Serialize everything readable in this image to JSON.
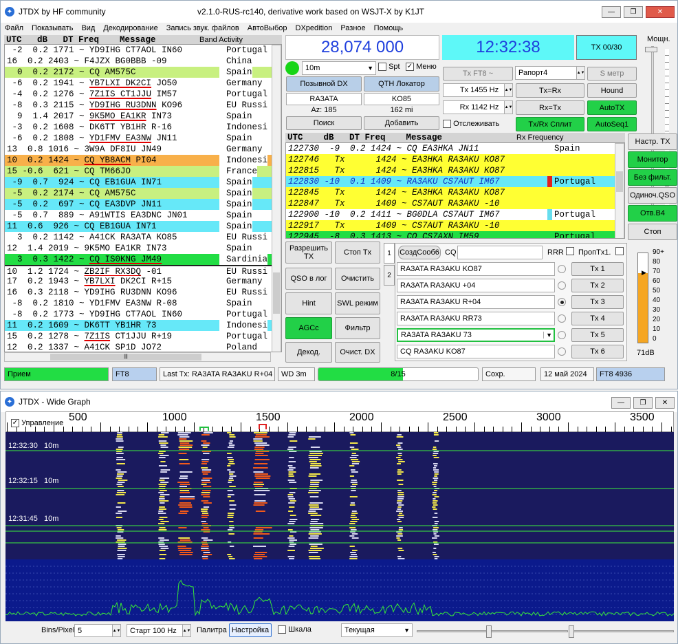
{
  "main": {
    "title": "JTDX   by HF community",
    "version": "v2.1.0-RUS-rc140, derivative work based on WSJT-X by K1JT",
    "menu": [
      "Файл",
      "Показывать",
      "Вид",
      "Декодирование",
      "Запись звук. файлов",
      "АвтоВыбор",
      "DXpedition",
      "Разное",
      "Помощь"
    ]
  },
  "band_activity": {
    "header": "UTC   dB   DT Freq    Message",
    "label": "Band Activity",
    "rows": [
      {
        "t": " -2  0.2 1771 ~ YD9IHG CT7AOL IN60",
        "c": "Portugal",
        "bg": "#ffffff",
        "bar": "#f0a030"
      },
      {
        "t": "16  0.2 2403 ~ F4JZX BG0BBB -09",
        "c": "China",
        "bg": "#ffffff",
        "bar": "#f0a030"
      },
      {
        "t": "  0  0.2 2172 ~ CQ AM575C",
        "c": "Spain",
        "bg": "#c8f080",
        "bar": ""
      },
      {
        "t": " -6  0.2 1941 ~ YB7LXI DK2CI JO50",
        "c": "Germany",
        "bg": "#ffffff",
        "bar": "",
        "u": "YB7LXI DK2CI"
      },
      {
        "t": " -4  0.2 1276 ~ 7Z1IS CT1JJU IM57",
        "c": "Portugal",
        "bg": "#ffffff",
        "bar": "",
        "u": "7Z1IS CT1JJU"
      },
      {
        "t": " -8  0.3 2115 ~ YD9IHG RU3DNN KO96",
        "c": "EU Russi",
        "bg": "#ffffff",
        "bar": "#22c040",
        "u": "YD9IHG RU3DNN"
      },
      {
        "t": "  9  1.4 2017 ~ 9K5MO EA1KR IN73",
        "c": "Spain",
        "bg": "#ffffff",
        "bar": "",
        "u": "9K5MO EA1KR"
      },
      {
        "t": " -3  0.2 1608 ~ DK6TT YB1HR R-16",
        "c": "Indonesi",
        "bg": "#ffffff",
        "bar": "#66ddee"
      },
      {
        "t": " -6  0.2 1808 ~ YD1FMV EA3NW JN11",
        "c": "Spain",
        "bg": "#ffffff",
        "bar": "",
        "u": "YD1FMV EA3NW"
      },
      {
        "t": "13  0.8 1016 ~ 3W9A DF8IU JN49",
        "c": "Germany",
        "bg": "#ffffff",
        "bar": ""
      },
      {
        "t": "10  0.2 1424 ~ CQ YB8ACM PI04",
        "c": "Indonesi",
        "bg": "#f8b04a",
        "bar": "",
        "u": "CQ YB8ACM"
      },
      {
        "t": "15 -0.6  621 ~ CQ TM66JO",
        "c": "France",
        "bg": "#c8f080",
        "bar": ""
      },
      {
        "t": " -9  0.7  924 ~ CQ EB1GUA IN71",
        "c": "Spain",
        "bg": "#66e8f8",
        "bar": ""
      },
      {
        "t": " -5  0.2 2174 ~ CQ AM575C",
        "c": "Spain",
        "bg": "#c8f080",
        "bar": ""
      },
      {
        "t": " -5  0.2  697 ~ CQ EA3DVP JN11",
        "c": "Spain",
        "bg": "#66e8f8",
        "bar": ""
      },
      {
        "t": " -5  0.7  889 ~ A91WTIS EA3DNC JN01",
        "c": "Spain",
        "bg": "#ffffff",
        "bar": ""
      },
      {
        "t": "11  0.6  926 ~ CQ EB1GUA IN71",
        "c": "Spain",
        "bg": "#66e8f8",
        "bar": ""
      },
      {
        "t": "  3  0.2 1142 ~ A41CK RA3ATA KO85",
        "c": "EU Russi",
        "bg": "#ffffff",
        "bar": ""
      },
      {
        "t": "12  1.4 2019 ~ 9K5MO EA1KR IN73",
        "c": "Spain",
        "bg": "#ffffff",
        "bar": ""
      },
      {
        "t": "  3  0.3 1422 ~ CQ IS0KNG JM49",
        "c": "Sardinia",
        "bg": "#22dd44",
        "bar": "",
        "u": "CQ IS0KNG JM49"
      },
      {
        "t": "10  1.2 1724 ~ ZB2IF RX3DQ -01",
        "c": "EU Russi",
        "bg": "#ffffff",
        "bar": "",
        "u": "ZB2IF RX3DQ",
        "sep": true
      },
      {
        "t": "17  0.2 1943 ~ YB7LXI DK2CI R+15",
        "c": "Germany",
        "bg": "#ffffff",
        "bar": "",
        "u": "YB7LXI"
      },
      {
        "t": "16  0.3 2118 ~ YD9IHG RU3DNN KO96",
        "c": "EU Russi",
        "bg": "#ffffff",
        "bar": "#22c040"
      },
      {
        "t": " -8  0.2 1810 ~ YD1FMV EA3NW R-08",
        "c": "Spain",
        "bg": "#ffffff",
        "bar": ""
      },
      {
        "t": " -8  0.2 1773 ~ YD9IHG CT7AOL IN60",
        "c": "Portugal",
        "bg": "#ffffff",
        "bar": "#f0a030"
      },
      {
        "t": "11  0.2 1609 ~ DK6TT YB1HR 73",
        "c": "Indonesi",
        "bg": "#66e8f8",
        "bar": ""
      },
      {
        "t": "15  0.2 1278 ~ 7Z1IS CT1JJU R+19",
        "c": "Portugal",
        "bg": "#ffffff",
        "bar": "",
        "u": "7Z1IS"
      },
      {
        "t": "12  0.2 1337 ~ A41CK SP1D JO72",
        "c": "Poland",
        "bg": "#ffffff",
        "bar": ""
      }
    ]
  },
  "freq": {
    "dial": "28,074 000",
    "clock": "12:32:38",
    "tx_counter": "TX 00/30",
    "power_label": "Мощн."
  },
  "band": {
    "value": "10m",
    "spt": "Spt",
    "menu": "Меню",
    "dx_call_btn": "Позывной DX",
    "dx_grid_btn": "QTH Локатор",
    "dx_call": "RA3ATA",
    "dx_grid": "KO85",
    "az": "Az: 185",
    "dist": "162 mi",
    "lookup": "Поиск",
    "add": "Добавить"
  },
  "controls": {
    "tx_mode": "Tx FT8 ~",
    "report": "Рапорт4",
    "smeter": "S метр",
    "tx_hz": "Tx  1455  Hz",
    "rx_hz": "Rx  1142  Hz",
    "tx_eq_rx": "Tx=Rx",
    "rx_eq_tx": "Rx=Tx",
    "hound": "Hound",
    "autotx": "AutoTX",
    "track": "Отслеживать",
    "split": "Tx/Rx Сплит",
    "autoseq": "AutoSeq1"
  },
  "rx_freq": {
    "header": "UTC    dB   DT Freq    Message",
    "label": "Rx Frequency",
    "rows": [
      {
        "t": "122730  -9  0.2 1424 ~ CQ EA3HKA JN11",
        "c": "Spain",
        "bg": "#ffffff",
        "bar": "",
        "col": "#000"
      },
      {
        "t": "122746   Tx      1424 ~ EA3HKA RA3AKU KO87",
        "c": "",
        "bg": "#ffff33",
        "bar": "",
        "col": "#000"
      },
      {
        "t": "122815   Tx      1424 ~ EA3HKA RA3AKU KO87",
        "c": "",
        "bg": "#ffff33",
        "bar": "",
        "col": "#000"
      },
      {
        "t": "122830 -10  0.1 1409 ~ RA3AKU CS7AUT IM67",
        "c": "Portugal",
        "bg": "#66e8f8",
        "bar": "#e02020",
        "col": "#1030c0"
      },
      {
        "t": "122845   Tx      1424 ~ EA3HKA RA3AKU KO87",
        "c": "",
        "bg": "#ffff33",
        "bar": "",
        "col": "#000"
      },
      {
        "t": "122847   Tx      1409 ~ CS7AUT RA3AKU -10",
        "c": "",
        "bg": "#ffff33",
        "bar": "",
        "col": "#000"
      },
      {
        "t": "122900 -10  0.2 1411 ~ BG0DLA CS7AUT IM67",
        "c": "Portugal",
        "bg": "#ffffff",
        "bar": "#66ddee",
        "col": "#000"
      },
      {
        "t": "122917   Tx      1409 ~ CS7AUT RA3AKU -10",
        "c": "",
        "bg": "#ffff33",
        "bar": "",
        "col": "#000"
      },
      {
        "t": "122945  -8  0.3 1413 ~ CQ CS7AXN IM59",
        "c": "Portugal",
        "bg": "#22dd44",
        "bar": "",
        "col": "#000"
      }
    ]
  },
  "right": {
    "setup_tx": "Настр. TX",
    "monitor": "Монитор",
    "no_filter": "Без фильт.",
    "single_qso": "Одиноч.QSO",
    "reply_b4": "Отв.B4",
    "stop": "Стоп",
    "meter_ticks": [
      "90+",
      "80",
      "70",
      "60",
      "50",
      "40",
      "30",
      "20",
      "10",
      "0"
    ],
    "meter_db": "71dB"
  },
  "left_btns": {
    "enable_tx": "Разрешить TX",
    "stop_tx": "Стоп Tx",
    "qso_log": "QSO в лог",
    "clear": "Очистить",
    "hint": "Hint",
    "swl": "SWL режим",
    "agcc": "AGCc",
    "filter": "Фильтр",
    "decode": "Декод.",
    "clear_dx": "Очист. DX"
  },
  "msgs": {
    "tab1": "1",
    "tab2": "2",
    "create": "СоздСооб6",
    "cq": "CQ",
    "rrr": "RRR",
    "skip_tx1": "ПропTx1.",
    "list": [
      {
        "text": "RA3ATA RA3AKU KO87",
        "btn": "Tx 1",
        "on": false
      },
      {
        "text": "RA3ATA RA3AKU +04",
        "btn": "Tx 2",
        "on": false
      },
      {
        "text": "RA3ATA RA3AKU R+04",
        "btn": "Tx 3",
        "on": true
      },
      {
        "text": "RA3ATA RA3AKU RR73",
        "btn": "Tx 4",
        "on": false
      },
      {
        "text": "RA3ATA RA3AKU 73",
        "btn": "Tx 5",
        "on": false
      },
      {
        "text": "CQ RA3AKU KO87",
        "btn": "Tx 6",
        "on": false
      }
    ]
  },
  "statusbar": {
    "rx": "Прием",
    "mode": "FT8",
    "last_tx": "Last Tx: RA3ATA RA3AKU R+04",
    "wd": "WD 3m",
    "progress": "8/15",
    "progress_value": 0.53,
    "save": "Сохр.",
    "date": "12 май 2024",
    "mode2": "FT8  4936"
  },
  "wide": {
    "title": "JTDX - Wide Graph",
    "control": "Управление",
    "axis": [
      "500",
      "1000",
      "1500",
      "2000",
      "2500",
      "3000",
      "3500"
    ],
    "time_labels": [
      {
        "t": "12:32:30   10m"
      },
      {
        "t": "12:32:15   10m"
      },
      {
        "t": "12:31:45   10m"
      }
    ],
    "bins_label": "Bins/Pixel",
    "bins_value": "5",
    "start": "Старт 100 Hz",
    "palette": "Палитра",
    "adjust": "Настройка",
    "scale": "Шкала",
    "current": "Текущая"
  }
}
